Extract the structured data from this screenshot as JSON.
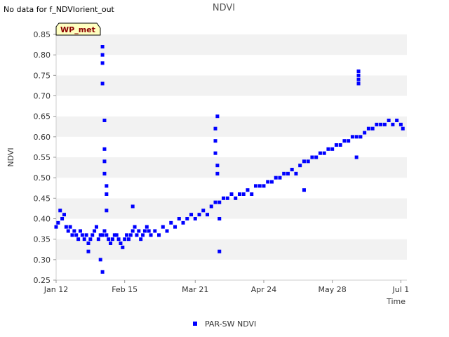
{
  "header": {
    "no_data_note": "No data for f_NDVIorient_out",
    "site_badge": "WP_met"
  },
  "colors": {
    "series": "#0000ff",
    "band_dark": "#f2f2f2",
    "band_light": "#ffffff",
    "badge_fill": "#ffffc0",
    "badge_text": "#8b0000"
  },
  "chart_data": {
    "type": "scatter",
    "title": "NDVI",
    "xlabel": "Time",
    "ylabel": "NDVI",
    "x_range": [
      "2024-01-12",
      "2024-07-04"
    ],
    "y_range": [
      0.25,
      0.85
    ],
    "x_ticks": [
      {
        "date": "2024-01-12",
        "label": "Jan 12"
      },
      {
        "date": "2024-02-15",
        "label": "Feb 15"
      },
      {
        "date": "2024-03-21",
        "label": "Mar 21"
      },
      {
        "date": "2024-04-24",
        "label": "Apr 24"
      },
      {
        "date": "2024-05-28",
        "label": "May 28"
      },
      {
        "date": "2024-07-01",
        "label": "Jul 1"
      }
    ],
    "y_ticks": [
      "0.25",
      "0.30",
      "0.35",
      "0.40",
      "0.45",
      "0.50",
      "0.55",
      "0.60",
      "0.65",
      "0.70",
      "0.75",
      "0.80",
      "0.85"
    ],
    "grid": "alternating horizontal bands",
    "legend_position": "bottom-center",
    "series": [
      {
        "name": "PAR-SW NDVI",
        "x": [
          "2024-01-12",
          "2024-01-13",
          "2024-01-14",
          "2024-01-15",
          "2024-01-16",
          "2024-01-17",
          "2024-01-18",
          "2024-01-19",
          "2024-01-20",
          "2024-01-21",
          "2024-01-22",
          "2024-01-23",
          "2024-01-24",
          "2024-01-25",
          "2024-01-26",
          "2024-01-27",
          "2024-01-28",
          "2024-01-29",
          "2024-01-30",
          "2024-01-31",
          "2024-02-01",
          "2024-02-02",
          "2024-02-03",
          "2024-02-04",
          "2024-02-05",
          "2024-02-06",
          "2024-02-07",
          "2024-02-08",
          "2024-02-09",
          "2024-02-10",
          "2024-02-11",
          "2024-02-12",
          "2024-02-13",
          "2024-02-14",
          "2024-02-15",
          "2024-02-16",
          "2024-02-17",
          "2024-02-18",
          "2024-02-19",
          "2024-02-20",
          "2024-02-21",
          "2024-02-22",
          "2024-02-23",
          "2024-02-24",
          "2024-02-25",
          "2024-02-26",
          "2024-02-27",
          "2024-02-28",
          "2024-03-01",
          "2024-03-03",
          "2024-03-05",
          "2024-03-07",
          "2024-03-09",
          "2024-03-11",
          "2024-03-13",
          "2024-03-15",
          "2024-03-17",
          "2024-03-19",
          "2024-03-21",
          "2024-03-23",
          "2024-03-25",
          "2024-03-27",
          "2024-03-29",
          "2024-03-31",
          "2024-04-02",
          "2024-04-04",
          "2024-04-06",
          "2024-04-08",
          "2024-04-10",
          "2024-04-12",
          "2024-04-14",
          "2024-04-16",
          "2024-04-18",
          "2024-04-20",
          "2024-04-22",
          "2024-04-24",
          "2024-04-26",
          "2024-04-28",
          "2024-04-30",
          "2024-05-02",
          "2024-05-04",
          "2024-05-06",
          "2024-05-08",
          "2024-05-10",
          "2024-05-12",
          "2024-05-14",
          "2024-05-16",
          "2024-05-18",
          "2024-05-20",
          "2024-05-22",
          "2024-05-24",
          "2024-05-26",
          "2024-05-28",
          "2024-05-30",
          "2024-06-01",
          "2024-06-03",
          "2024-06-05",
          "2024-06-07",
          "2024-06-09",
          "2024-06-11",
          "2024-06-13",
          "2024-06-15",
          "2024-06-17",
          "2024-06-19",
          "2024-06-21",
          "2024-06-23",
          "2024-06-25",
          "2024-06-27",
          "2024-06-29",
          "2024-07-01",
          "2024-07-02",
          "2024-02-04",
          "2024-02-04",
          "2024-02-04",
          "2024-02-04",
          "2024-02-05",
          "2024-02-05",
          "2024-02-05",
          "2024-02-05",
          "2024-02-06",
          "2024-02-06",
          "2024-02-06",
          "2024-03-31",
          "2024-03-31",
          "2024-03-31",
          "2024-04-01",
          "2024-04-01",
          "2024-04-01",
          "2024-04-02",
          "2024-04-02",
          "2024-06-10",
          "2024-06-10",
          "2024-06-10",
          "2024-06-10",
          "2024-01-28",
          "2024-02-04",
          "2024-02-03",
          "2024-02-19",
          "2024-05-14",
          "2024-06-09"
        ],
        "y": [
          0.38,
          0.39,
          0.42,
          0.4,
          0.41,
          0.38,
          0.37,
          0.38,
          0.36,
          0.37,
          0.36,
          0.35,
          0.37,
          0.36,
          0.35,
          0.36,
          0.34,
          0.35,
          0.36,
          0.37,
          0.38,
          0.35,
          0.36,
          0.36,
          0.37,
          0.36,
          0.35,
          0.34,
          0.35,
          0.36,
          0.36,
          0.35,
          0.34,
          0.33,
          0.35,
          0.36,
          0.35,
          0.36,
          0.37,
          0.38,
          0.36,
          0.37,
          0.35,
          0.36,
          0.37,
          0.38,
          0.37,
          0.36,
          0.37,
          0.36,
          0.38,
          0.37,
          0.39,
          0.38,
          0.4,
          0.39,
          0.4,
          0.41,
          0.4,
          0.41,
          0.42,
          0.41,
          0.43,
          0.44,
          0.44,
          0.45,
          0.45,
          0.46,
          0.45,
          0.46,
          0.46,
          0.47,
          0.46,
          0.48,
          0.48,
          0.48,
          0.49,
          0.49,
          0.5,
          0.5,
          0.51,
          0.51,
          0.52,
          0.51,
          0.53,
          0.54,
          0.54,
          0.55,
          0.55,
          0.56,
          0.56,
          0.57,
          0.57,
          0.58,
          0.58,
          0.59,
          0.59,
          0.6,
          0.6,
          0.6,
          0.61,
          0.62,
          0.62,
          0.63,
          0.63,
          0.63,
          0.64,
          0.63,
          0.64,
          0.63,
          0.62,
          0.82,
          0.8,
          0.78,
          0.73,
          0.64,
          0.57,
          0.54,
          0.51,
          0.48,
          0.46,
          0.42,
          0.62,
          0.59,
          0.56,
          0.65,
          0.53,
          0.51,
          0.4,
          0.32,
          0.76,
          0.75,
          0.74,
          0.73,
          0.32,
          0.27,
          0.3,
          0.43,
          0.47,
          0.55
        ]
      }
    ]
  }
}
